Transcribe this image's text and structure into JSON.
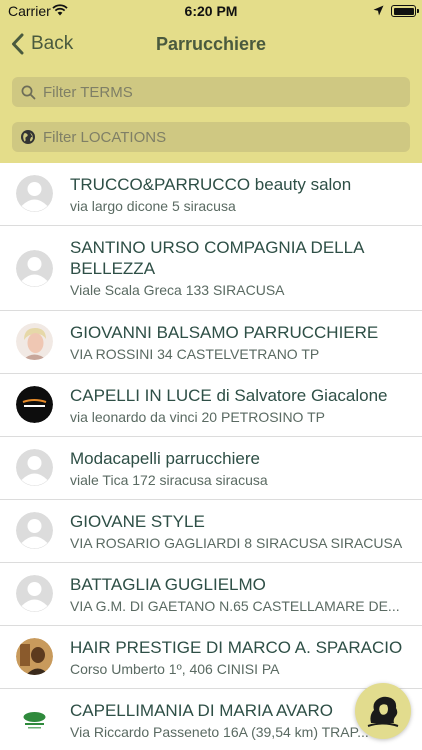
{
  "status": {
    "carrier": "Carrier",
    "time": "6:20 PM"
  },
  "nav": {
    "back_label": "Back",
    "title": "Parrucchiere"
  },
  "filters": {
    "terms_placeholder": "Filter TERMS",
    "locations_placeholder": "Filter LOCATIONS"
  },
  "colors": {
    "header": "#e4dd8a",
    "filter_bg": "#cfc882",
    "title_text": "#2e4f46",
    "nav_text": "#4a5a3e"
  },
  "items": [
    {
      "name": "TRUCCO&PARRUCCO beauty salon",
      "address": "via largo dicone 5 siracusa",
      "avatar": "default-avatar-icon"
    },
    {
      "name": "SANTINO URSO COMPAGNIA DELLA BELLEZZA",
      "address": "Viale Scala Greca 133 SIRACUSA",
      "avatar": "default-avatar-icon"
    },
    {
      "name": "GIOVANNI BALSAMO PARRUCCHIERE",
      "address": "VIA ROSSINI 34 CASTELVETRANO TP",
      "avatar": "portrait-photo"
    },
    {
      "name": "CAPELLI IN LUCE di Salvatore Giacalone",
      "address": "via leonardo da vinci 20 PETROSINO TP",
      "avatar": "logo-badge"
    },
    {
      "name": "Modacapelli parrucchiere",
      "address": "viale Tica 172 siracusa siracusa",
      "avatar": "default-avatar-icon"
    },
    {
      "name": "GIOVANE STYLE",
      "address": "VIA ROSARIO GAGLIARDI 8 SIRACUSA SIRACUSA",
      "avatar": "default-avatar-icon"
    },
    {
      "name": "BATTAGLIA GUGLIELMO",
      "address": "VIA G.M. DI GAETANO N.65 CASTELLAMARE DE...",
      "avatar": "default-avatar-icon"
    },
    {
      "name": "HAIR PRESTIGE DI MARCO A. SPARACIO",
      "address": "Corso Umberto 1º, 406 CINISI PA",
      "avatar": "photo"
    },
    {
      "name": "CAPELLIMANIA DI MARIA AVARO",
      "address": "Via Riccardo Passeneto 16A (39,54 km) TRAP...",
      "avatar": "green-logo"
    }
  ]
}
